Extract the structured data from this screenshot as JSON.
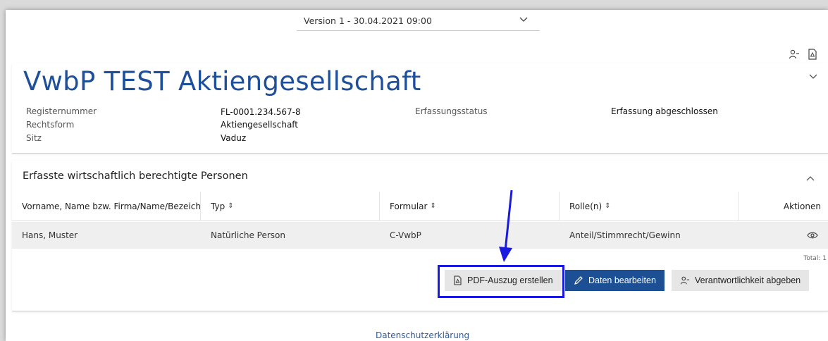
{
  "version_select": {
    "value": "Version 1 - 30.04.2021 09:00"
  },
  "top_icons": [
    "person-minus-icon",
    "pdf-file-icon"
  ],
  "company": {
    "name": "VwbP TEST Aktiengesellschaft",
    "fields": {
      "registernummer_label": "Registernummer",
      "registernummer_value": "FL-0001.234.567-8",
      "rechtsform_label": "Rechtsform",
      "rechtsform_value": "Aktiengesellschaft",
      "sitz_label": "Sitz",
      "sitz_value": "Vaduz",
      "status_label": "Erfassungsstatus",
      "status_value": "Erfassung abgeschlossen"
    }
  },
  "persons": {
    "title": "Erfasste wirtschaftlich berechtigte Personen",
    "columns": [
      "Vorname, Name bzw. Firma/Name/Bezeichnung",
      "Typ",
      "Formular",
      "Rolle(n)",
      "Aktionen"
    ],
    "rows": [
      {
        "name": "Hans, Muster",
        "typ": "Natürliche Person",
        "formular": "C-VwbP",
        "rollen": "Anteil/Stimmrecht/Gewinn"
      }
    ],
    "total": "Total: 1"
  },
  "buttons": {
    "pdf": "PDF-Auszug erstellen",
    "edit": "Daten bearbeiten",
    "handover": "Verantwortlichkeit abgeben"
  },
  "footer": {
    "link": "Datenschutzerklärung"
  },
  "colors": {
    "accent": "#1c4f94",
    "title": "#1e4f9a",
    "highlight": "#1a1adf"
  }
}
